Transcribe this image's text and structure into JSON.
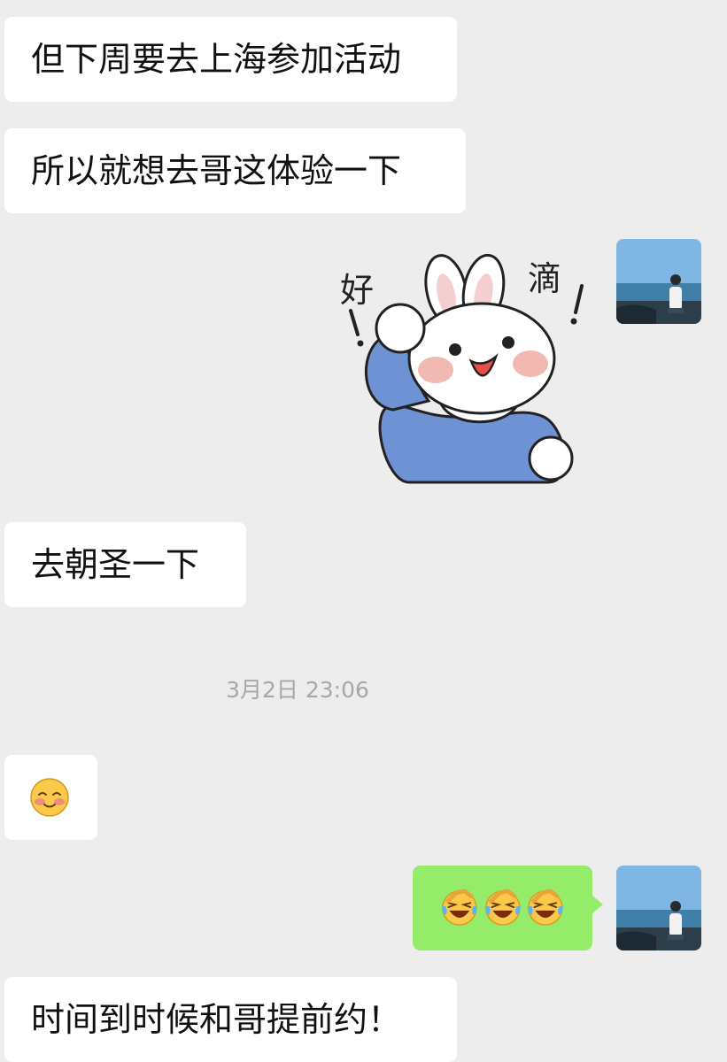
{
  "messages": [
    {
      "side": "left",
      "text": "但下周要去上海参加活动"
    },
    {
      "side": "left",
      "text": "所以就想去哥这体验一下"
    },
    {
      "side": "right",
      "type": "sticker",
      "sticker_text": [
        "好",
        "滴"
      ],
      "sticker_marks": "!"
    },
    {
      "side": "left",
      "text": "去朝圣一下"
    },
    {
      "side": "left",
      "type": "emoji",
      "emoji": "blushing-smile-emoji"
    },
    {
      "side": "right",
      "type": "emoji",
      "emoji": "laughing-crying-emoji",
      "count": 3
    },
    {
      "side": "left",
      "text": "时间到时候和哥提前约！"
    }
  ],
  "timestamp": "3月2日 23:06",
  "colors": {
    "background": "#ededed",
    "incoming_bubble": "#ffffff",
    "outgoing_bubble": "#95ec69",
    "timestamp_text": "#a7a7a7",
    "sticker_shirt": "#6e92d4"
  },
  "avatar": {
    "icon": "seaside-person-avatar"
  }
}
